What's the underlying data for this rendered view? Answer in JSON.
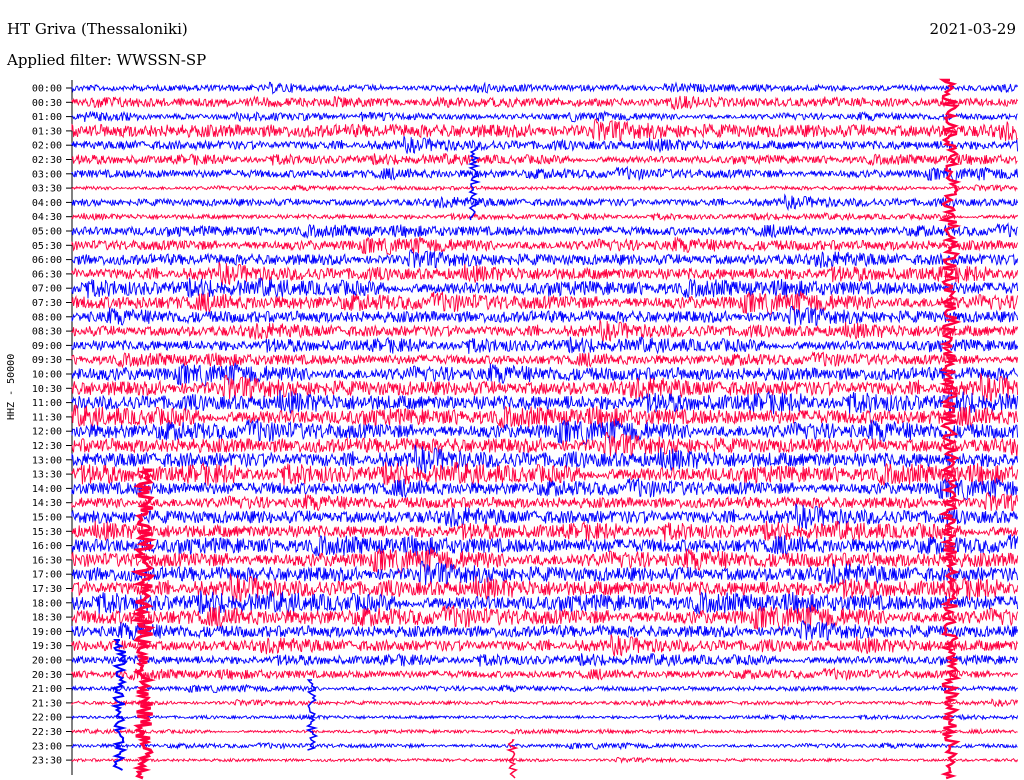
{
  "header": {
    "station": "HT Griva (Thessaloniki)",
    "date": "2021-03-29",
    "filter": "Applied filter: WWSSN-SP"
  },
  "chart_data": {
    "type": "helicorder",
    "ylabel": "HHZ - 50000",
    "row_labels": [
      "00:00",
      "00:30",
      "01:00",
      "01:30",
      "02:00",
      "02:30",
      "03:00",
      "03:30",
      "04:00",
      "04:30",
      "05:00",
      "05:30",
      "06:00",
      "06:30",
      "07:00",
      "07:30",
      "08:00",
      "08:30",
      "09:00",
      "09:30",
      "10:00",
      "10:30",
      "11:00",
      "11:30",
      "12:00",
      "12:30",
      "13:00",
      "13:30",
      "14:00",
      "14:30",
      "15:00",
      "15:30",
      "16:00",
      "16:30",
      "17:00",
      "17:30",
      "18:00",
      "18:30",
      "19:00",
      "19:30",
      "20:00",
      "20:30",
      "21:00",
      "21:30",
      "22:00",
      "22:30",
      "23:00",
      "23:30"
    ],
    "row_colors": [
      "#0000ff",
      "#ff0040"
    ],
    "row_noise_level": [
      0.45,
      0.55,
      0.4,
      0.9,
      0.6,
      0.5,
      0.55,
      0.25,
      0.5,
      0.3,
      0.6,
      0.7,
      0.75,
      0.8,
      0.85,
      0.9,
      0.8,
      0.75,
      0.7,
      0.65,
      0.9,
      1.0,
      1.0,
      1.0,
      1.0,
      1.0,
      1.0,
      1.0,
      0.85,
      0.75,
      0.9,
      0.85,
      0.95,
      1.0,
      1.0,
      1.0,
      1.0,
      1.0,
      0.8,
      0.75,
      0.55,
      0.5,
      0.3,
      0.25,
      0.2,
      0.2,
      0.25,
      0.2
    ]
  }
}
